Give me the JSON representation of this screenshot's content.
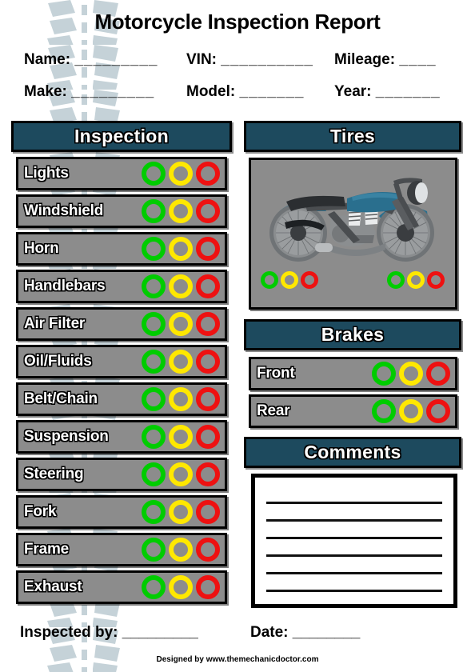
{
  "document": {
    "title": "Motorcycle Inspection Report",
    "credit": "Designed by www.themechanicdoctor.com"
  },
  "colors": {
    "header_bar": "#1d4a5e",
    "row_gray": "#8c8c8c",
    "green": "#00cc00",
    "yellow": "#ffe800",
    "red": "#ee1111",
    "tread_watermark": "#c5d2d8",
    "tank_teal": "#2a6f8e"
  },
  "header_fields": {
    "row1": [
      {
        "label": "Name:",
        "blank": "_________",
        "value": ""
      },
      {
        "label": "VIN:",
        "blank": "__________",
        "value": ""
      },
      {
        "label": "Mileage:",
        "blank": "____",
        "value": ""
      }
    ],
    "row2": [
      {
        "label": "Make:",
        "blank": "_________",
        "value": ""
      },
      {
        "label": "Model:",
        "blank": "_______",
        "value": ""
      },
      {
        "label": "Year:",
        "blank": "_______",
        "value": ""
      }
    ]
  },
  "sections": {
    "inspection": {
      "heading": "Inspection",
      "rating_options": [
        "green",
        "yellow",
        "red"
      ],
      "items": [
        {
          "label": "Lights",
          "selected": null
        },
        {
          "label": "Windshield",
          "selected": null
        },
        {
          "label": "Horn",
          "selected": null
        },
        {
          "label": "Handlebars",
          "selected": null
        },
        {
          "label": "Air Filter",
          "selected": null
        },
        {
          "label": "Oil/Fluids",
          "selected": null
        },
        {
          "label": "Belt/Chain",
          "selected": null
        },
        {
          "label": "Suspension",
          "selected": null
        },
        {
          "label": "Steering",
          "selected": null
        },
        {
          "label": "Fork",
          "selected": null
        },
        {
          "label": "Frame",
          "selected": null
        },
        {
          "label": "Exhaust",
          "selected": null
        }
      ]
    },
    "tires": {
      "heading": "Tires",
      "illustration": "motorcycle-side-view",
      "groups": [
        {
          "name": "rear-tire",
          "options": [
            "green",
            "yellow",
            "red"
          ],
          "selected": null
        },
        {
          "name": "front-tire",
          "options": [
            "green",
            "yellow",
            "red"
          ],
          "selected": null
        }
      ]
    },
    "brakes": {
      "heading": "Brakes",
      "items": [
        {
          "label": "Front",
          "selected": null
        },
        {
          "label": "Rear",
          "selected": null
        }
      ]
    },
    "comments": {
      "heading": "Comments",
      "line_count": 6,
      "value": ""
    }
  },
  "footer_fields": [
    {
      "label": "Inspected by:",
      "blank": "_________",
      "value": ""
    },
    {
      "label": "Date:",
      "blank": "________",
      "value": ""
    }
  ]
}
